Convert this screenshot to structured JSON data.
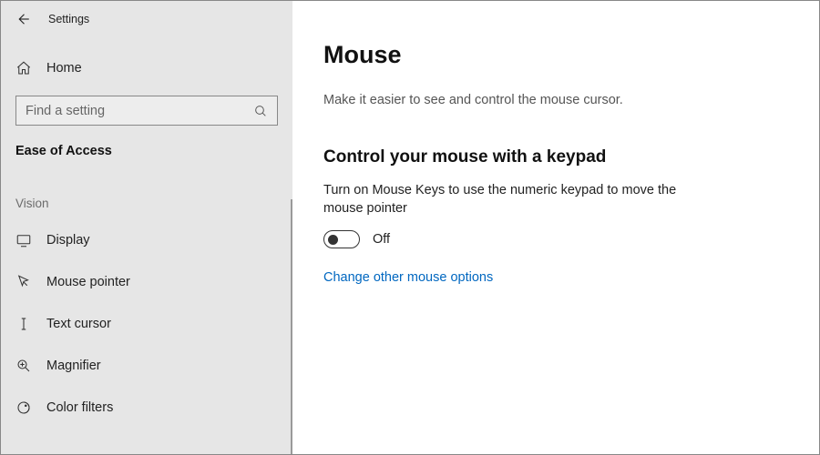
{
  "topbar": {
    "title": "Settings"
  },
  "home": {
    "label": "Home"
  },
  "search": {
    "placeholder": "Find a setting"
  },
  "category": "Ease of Access",
  "group": "Vision",
  "nav": {
    "items": [
      {
        "label": "Display"
      },
      {
        "label": "Mouse pointer"
      },
      {
        "label": "Text cursor"
      },
      {
        "label": "Magnifier"
      },
      {
        "label": "Color filters"
      }
    ]
  },
  "main": {
    "title": "Mouse",
    "subtitle": "Make it easier to see and control the mouse cursor.",
    "section_title": "Control your mouse with a keypad",
    "section_desc": "Turn on Mouse Keys to use the numeric keypad to move the mouse pointer",
    "toggle_state": "Off",
    "link": "Change other mouse options"
  }
}
